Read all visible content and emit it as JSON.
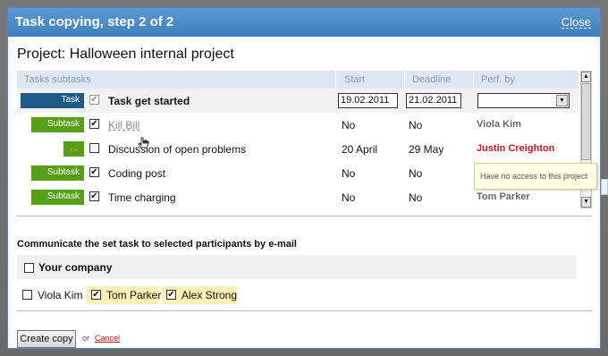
{
  "dialog": {
    "title": "Task copying, step 2 of 2",
    "close_label": "Close",
    "project_title": "Project: Halloween internal project"
  },
  "table": {
    "headers": {
      "tasks": "Tasks subtasks",
      "start": "Start",
      "deadline": "Deadline",
      "perf_by": "Perf. by"
    },
    "rows": [
      {
        "tag": "Task",
        "checked": true,
        "name": "Task get started",
        "start": "19.02.2011",
        "deadline": "21.02.2011",
        "perf_by": ""
      },
      {
        "tag": "Subtask",
        "checked": true,
        "name": "Kill Bill",
        "start": "No",
        "deadline": "No",
        "perf_by": "Viola Kim"
      },
      {
        "tag": "...",
        "checked": false,
        "name": "Discussion of open problems",
        "start": "20 April",
        "deadline": "29 May",
        "perf_by": "Justin Creighton"
      },
      {
        "tag": "Subtask",
        "checked": true,
        "name": "Coding post",
        "start": "No",
        "deadline": "No",
        "perf_by": ""
      },
      {
        "tag": "Subtask",
        "checked": true,
        "name": "Time charging",
        "start": "No",
        "deadline": "No",
        "perf_by": "Tom Parker"
      }
    ],
    "tooltip": "Have no access to this project"
  },
  "email": {
    "title": "Communicate the set task to selected participants by e-mail",
    "company_label": "Your company",
    "company_checked": false,
    "participants": [
      {
        "name": "Viola Kim",
        "checked": false
      },
      {
        "name": "Tom Parker",
        "checked": true
      },
      {
        "name": "Alex Strong",
        "checked": true
      }
    ]
  },
  "footer": {
    "create_label": "Create copy",
    "or_label": "or",
    "cancel_label": "Cancel"
  },
  "colors": {
    "header": "#3d7ebb",
    "task_tag": "#1f5a84",
    "subtask_tag": "#57a016",
    "no_access_user": "#d4181a",
    "highlight": "#fcefb4"
  }
}
